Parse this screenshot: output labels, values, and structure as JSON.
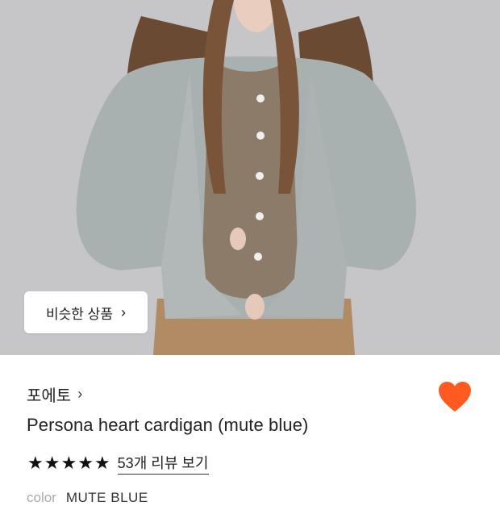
{
  "colors": {
    "heart": "#ff5a1f",
    "text": "#222222",
    "muted": "#aaaaaa"
  },
  "photo": {
    "alt_icon": "product-photo"
  },
  "similar_button": {
    "label": "비슷한 상품",
    "icon": "chevron-right-icon"
  },
  "brand": {
    "name": "포에토",
    "icon": "chevron-right-icon"
  },
  "product": {
    "name": "Persona heart cardigan (mute blue)",
    "rating_stars": 5,
    "star_glyph": "★",
    "review_link": "53개 리뷰 보기"
  },
  "like": {
    "icon": "heart-icon",
    "active": true
  },
  "option": {
    "label": "color",
    "value": "MUTE BLUE"
  }
}
